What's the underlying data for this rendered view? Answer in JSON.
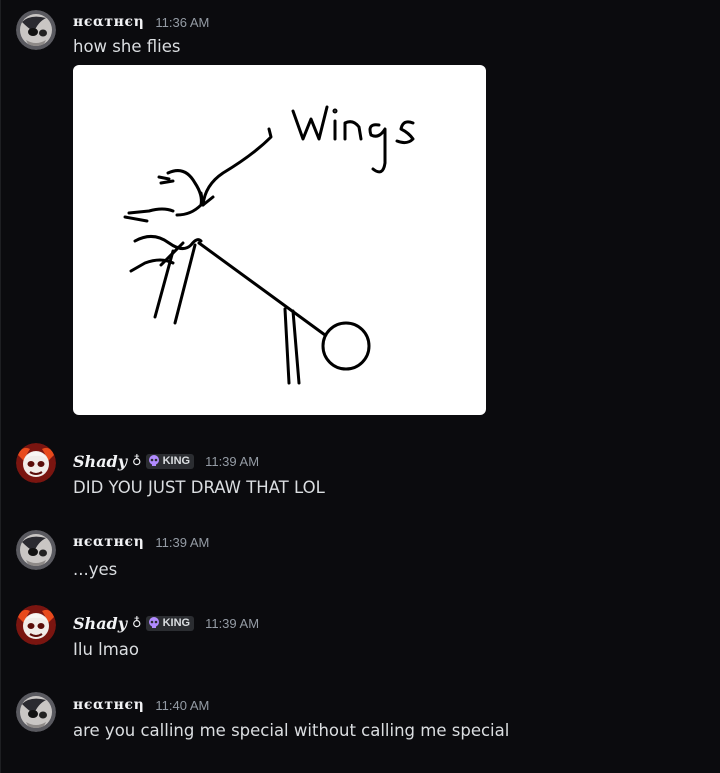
{
  "users": {
    "heathen": {
      "name": "нєαтнєη"
    },
    "shady": {
      "name": "Shady",
      "glyph": "♁",
      "role": "KING",
      "role_icon": "skull-icon"
    }
  },
  "colors": {
    "background": "#0b0b0e",
    "text": "#dbdee1",
    "timestamp": "#949ba4",
    "role_tag_bg": "#2b2d31",
    "role_icon": "#b18bff"
  },
  "messages": [
    {
      "author": "нєαтнєη",
      "time": "11:36 AM",
      "text": "how she flies",
      "attachment": {
        "drawing_text": "Wings"
      }
    },
    {
      "author": "Shady",
      "time": "11:39 AM",
      "text": "DID YOU JUST DRAW THAT LOL"
    },
    {
      "author": "нєαтнєη",
      "time": "11:39 AM",
      "text": "...yes"
    },
    {
      "author": "Shady",
      "time": "11:39 AM",
      "text": "Ilu lmao"
    },
    {
      "author": "нєαтнєη",
      "time": "11:40 AM",
      "text": "are you calling me special without calling me special"
    }
  ]
}
